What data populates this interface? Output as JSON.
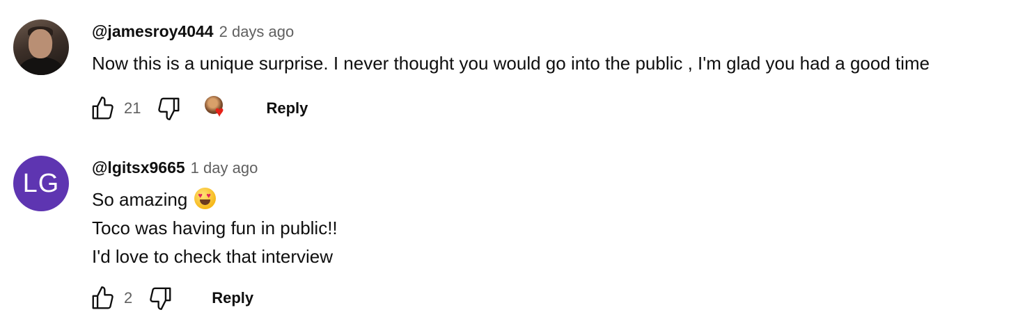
{
  "comments": [
    {
      "author": "@jamesroy4044",
      "time": "2 days ago",
      "avatar_icon": "user-photo-avatar",
      "text_lines": [
        "Now this is a unique surprise. I never thought you would go into the public , I'm glad you had a good time"
      ],
      "likes": "21",
      "creator_hearted": true,
      "reply_label": "Reply"
    },
    {
      "author": "@lgitsx9665",
      "time": "1 day ago",
      "avatar_initials": "LG",
      "avatar_color": "#5e35b1",
      "text_lines": [
        "So amazing",
        "Toco was having fun in public!!",
        "I'd love to check that interview"
      ],
      "emoji": "heart-eyes-emoji",
      "likes": "2",
      "creator_hearted": false,
      "reply_label": "Reply"
    }
  ],
  "colors": {
    "text": "#0f0f0f",
    "secondary": "#606060",
    "heart": "#e62117"
  }
}
